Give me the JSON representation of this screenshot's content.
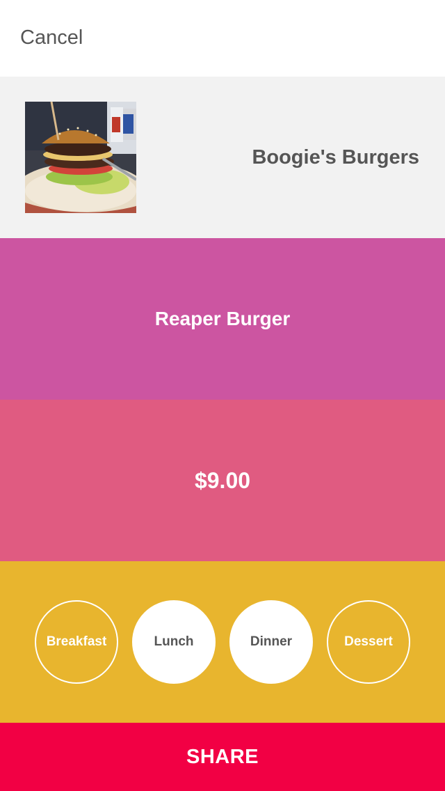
{
  "topbar": {
    "cancel_label": "Cancel"
  },
  "place": {
    "name": "Boogie's Burgers",
    "photo": "burger-photo"
  },
  "dish": {
    "name": "Reaper Burger",
    "color": "#cc55a1"
  },
  "price": {
    "value": "$9.00",
    "color": "#e05b81"
  },
  "meals": {
    "color": "#e8b52e",
    "options": [
      {
        "label": "Breakfast",
        "selected": false
      },
      {
        "label": "Lunch",
        "selected": true
      },
      {
        "label": "Dinner",
        "selected": true
      },
      {
        "label": "Dessert",
        "selected": false
      }
    ]
  },
  "share": {
    "label": "SHARE",
    "color": "#f20044"
  }
}
